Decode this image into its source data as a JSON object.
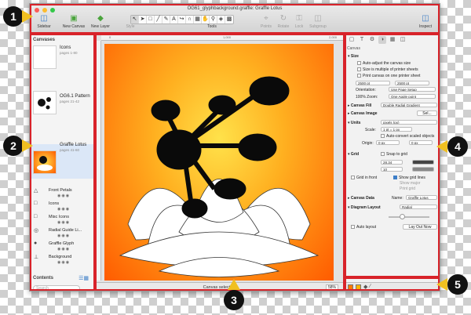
{
  "window": {
    "title": "OG61_glyphbackground.graffle: Graffle Lotus",
    "traffic_colors": [
      "#fc5c57",
      "#fdbc2e",
      "#34c84a"
    ]
  },
  "toolbar": {
    "sidebar_label": "Sidebar",
    "new_canvas_label": "New Canvas",
    "new_layer_label": "New Layer",
    "tools_label": "Tools",
    "style_label": "Style",
    "points_label": "Points",
    "rotate_label": "Rotate",
    "lock_label": "Lock",
    "subgroup_label": "Subgroup",
    "inspect_label": "Inspect",
    "tool_icons": [
      "arrow-selection-icon",
      "pointer-icon",
      "rect-shape-icon",
      "line-icon",
      "pen-icon",
      "text-icon",
      "connect-icon",
      "magnet-icon",
      "table-icon",
      "hand-icon",
      "zoom-icon",
      "diagram-icon",
      "stamp-icon"
    ]
  },
  "sidebar": {
    "canvases_header": "Canvases",
    "contents_header": "Contents",
    "search_placeholder": "Search",
    "canvases": [
      {
        "name": "Icons",
        "pages": "pages 1-80",
        "info": "Auto-resized: CF\nSize: 2000 x 2000\nUnits: pixels (px)\nSnap to Grid: On"
      },
      {
        "name": "OG6.1 Pattern",
        "pages": "pages 21-42",
        "info": "Auto-resized: CF\nSize: 2000 x 2000\nUnits: pixels (px)\nSnap to Grid: On"
      },
      {
        "name": "Graffle Lotus",
        "pages": "pages 41-60",
        "info": "Auto-resized: CF\nSize: 2500 x 2500\nUnits: pixels (px)\nSnap to Grid: On"
      }
    ],
    "layers": [
      {
        "name": "Front Petals",
        "icon": "layer-icon"
      },
      {
        "name": "Icons",
        "icon": "layer-icon"
      },
      {
        "name": "Misc Icons",
        "icon": "layer-icon"
      },
      {
        "name": "Radial Guide Li...",
        "icon": "layer-icon"
      },
      {
        "name": "Graffle Glyph",
        "icon": "layer-icon"
      },
      {
        "name": "Background",
        "icon": "layer-icon"
      }
    ]
  },
  "canvas": {
    "status": "Canvas selected",
    "zoom": "58%",
    "ruler_marks": [
      "0",
      "1,000",
      "2,000"
    ]
  },
  "inspector": {
    "header": "Canvas",
    "size_section": "Size",
    "auto_adjust": "Auto-adjust the canvas size",
    "multiple_printer": "Size is multiple of printer sheets",
    "print_one_page": "Print canvas on one printer sheet",
    "width": "2500 pt",
    "height": "2500 pt",
    "orientation_label": "Orientation:",
    "orientation_value": "Use Page Setup",
    "zoom_label": "100% Zoom:",
    "zoom_value": "One Apple point",
    "fill_section": "Canvas Fill",
    "fill_value": "Double Radial Gradient",
    "image_section": "Canvas Image",
    "image_button": "Sel...",
    "units_section": "Units",
    "units_value": "pixels (px)",
    "scale_label": "Scale:",
    "scale_value": "1 pt = 1 px",
    "auto_convert": "Auto-convert scaled objects",
    "origin_label": "Origin:",
    "origin_x": "0 px",
    "origin_y": "0 px",
    "grid_section": "Grid",
    "snap_to_grid": "Snap to grid",
    "grid_major": "28.34",
    "grid_minor": "10",
    "grid_in_front": "Grid in front",
    "show_grid_lines": "Show grid lines",
    "show_major": "Show major",
    "print_grid": "Print grid",
    "data_section": "Canvas Data",
    "name_label": "Name:",
    "name_value": "Graffle Lotus",
    "layout_section": "Diagram Layout",
    "layout_value": "Radial",
    "auto_layout": "Auto layout",
    "lay_out_now": "Lay Out Now"
  },
  "callouts": [
    "1",
    "2",
    "3",
    "4",
    "5"
  ]
}
